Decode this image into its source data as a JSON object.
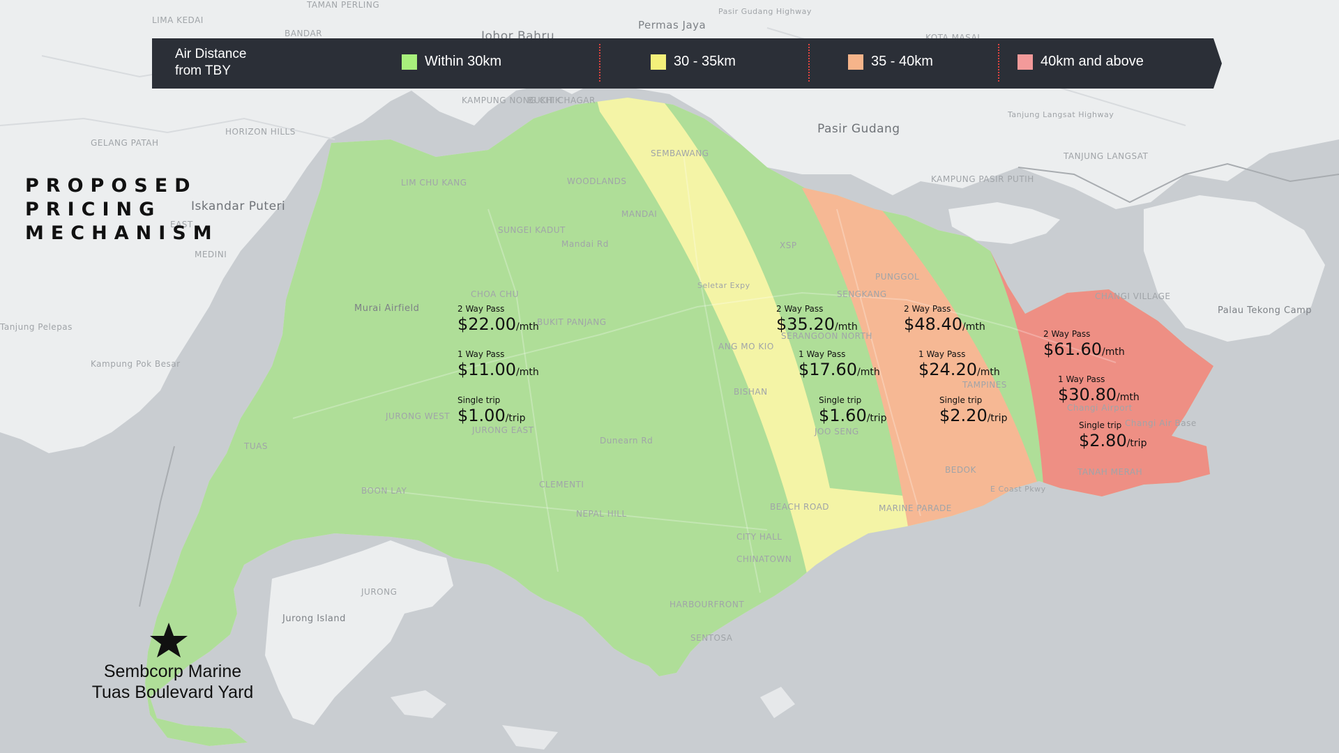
{
  "title": "PROPOSED PRICING MECHANISM",
  "legend": {
    "title_line1": "Air Distance",
    "title_line2": "from TBY",
    "items": [
      {
        "label": "Within 30km",
        "color": "#a8f07c"
      },
      {
        "label": "30 - 35km",
        "color": "#f4f07a"
      },
      {
        "label": "35 - 40km",
        "color": "#f6b48a"
      },
      {
        "label": "40km and above",
        "color": "#f39a9a"
      }
    ],
    "background": "#2b2f37"
  },
  "zones": [
    {
      "name": "within-30km",
      "passes": [
        {
          "label": "2 Way Pass",
          "price": "$22.00",
          "unit": "/mth"
        },
        {
          "label": "1 Way Pass",
          "price": "$11.00",
          "unit": "/mth"
        },
        {
          "label": "Single trip",
          "price": "$1.00",
          "unit": "/trip"
        }
      ]
    },
    {
      "name": "30-35km",
      "passes": [
        {
          "label": "2 Way Pass",
          "price": "$35.20",
          "unit": "/mth"
        },
        {
          "label": "1 Way Pass",
          "price": "$17.60",
          "unit": "/mth"
        },
        {
          "label": "Single trip",
          "price": "$1.60",
          "unit": "/trip"
        }
      ]
    },
    {
      "name": "35-40km",
      "passes": [
        {
          "label": "2 Way Pass",
          "price": "$48.40",
          "unit": "/mth"
        },
        {
          "label": "1 Way Pass",
          "price": "$24.20",
          "unit": "/mth"
        },
        {
          "label": "Single trip",
          "price": "$2.20",
          "unit": "/trip"
        }
      ]
    },
    {
      "name": "40km-above",
      "passes": [
        {
          "label": "2 Way Pass",
          "price": "$61.60",
          "unit": "/mth"
        },
        {
          "label": "1 Way Pass",
          "price": "$30.80",
          "unit": "/mth"
        },
        {
          "label": "Single trip",
          "price": "$2.80",
          "unit": "/trip"
        }
      ]
    }
  ],
  "yard": {
    "line1": "Sembcorp Marine",
    "line2": "Tuas Boulevard Yard",
    "marker": "star-icon"
  },
  "places": {
    "lima_kedai": "LIMA KEDAI",
    "taman_perling": "TAMAN PERLING",
    "bandar": "BANDAR",
    "permas_jaya": "Permas Jaya",
    "johor_bahru": "Johor Bahru",
    "pasir_gudang_hwy": "Pasir Gudang Highway",
    "kota_masai": "KOTA MASAI",
    "kampung_nong_chik": "KAMPUNG NONG CHIK",
    "bukit_chagar": "BUKIT CHAGAR",
    "tanjung_langsat_hwy": "Tanjung Langsat Highway",
    "gelang_patah": "GELANG PATAH",
    "horizon_hills": "HORIZON HILLS",
    "pasir_gudang": "Pasir Gudang",
    "tanjung_langsat": "TANJUNG LANGSAT",
    "kampung_pasir_putih": "KAMPUNG PASIR PUTIH",
    "iskandar_puteri": "Iskandar Puteri",
    "east": "EAST",
    "medini": "MEDINI",
    "lim_chu_kang": "LIM CHU KANG",
    "woodlands": "WOODLANDS",
    "sembawang": "SEMBAWANG",
    "mandai": "MANDAI",
    "sungei_kadut": "SUNGEI KADUT",
    "mandai_rd": "Mandai Rd",
    "xsp": "XSP",
    "punggol": "PUNGGOL",
    "sengkang": "SENGKANG",
    "seletar_expy": "Seletar Expy",
    "murai_airfield": "Murai Airfield",
    "choa_chu": "CHOA CHU",
    "bukit_panjang": "BUKIT PANJANG",
    "tanjung_pelepas": "Tanjung Pelepas",
    "kampung_pok_besar": "Kampung Pok Besar",
    "serangoon_north": "SERANGOON NORTH",
    "ang_mo_kio": "ANG MO KIO",
    "bishan": "BISHAN",
    "tampines": "TAMPINES",
    "changi_village": "CHANGI VILLAGE",
    "palau_tekong_camp": "Palau Tekong Camp",
    "changi_airport": "Changi Airport",
    "changi_air_base": "Changi Air Base",
    "jurong_west": "JURONG WEST",
    "jurong_east": "JURONG EAST",
    "tuas": "TUAS",
    "dunearn_rd": "Dunearn Rd",
    "joo_seng": "JOO SENG",
    "bedok": "BEDOK",
    "tanah_merah": "TANAH MERAH",
    "e_coast_pkwy": "E Coast Pkwy",
    "boon_lay": "BOON LAY",
    "clementi": "CLEMENTI",
    "beach_road": "BEACH ROAD",
    "marine_parade": "MARINE PARADE",
    "nepal_hill": "NEPAL HILL",
    "city_hall": "CITY HALL",
    "chinatown": "CHINATOWN",
    "jurong": "JURONG",
    "jurong_island": "Jurong Island",
    "harbourfront": "HARBOURFRONT",
    "sentosa": "SENTOSA"
  }
}
